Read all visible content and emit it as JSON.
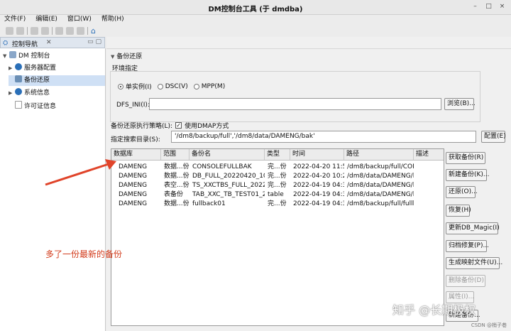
{
  "window": {
    "title": "DM控制台工具 (于 dmdba)",
    "minimize": "–",
    "maximize": "□",
    "close": "×"
  },
  "menu": [
    "文件(F)",
    "编辑(E)",
    "窗口(W)",
    "帮助(H)"
  ],
  "nav": {
    "tab_label": "控制导航",
    "tab_close": "✕",
    "items": [
      {
        "label": "DM 控制台",
        "level": 0,
        "expanded": true
      },
      {
        "label": "服务器配置",
        "level": 1,
        "expanded": false
      },
      {
        "label": "备份还原",
        "level": 1,
        "selected": true
      },
      {
        "label": "系统信息",
        "level": 1,
        "expanded": false
      },
      {
        "label": "许可证信息",
        "level": 1
      }
    ]
  },
  "panel": {
    "section_title": "备份还原",
    "env_group": "环境指定",
    "radios": [
      {
        "label": "单实例(I)",
        "checked": true
      },
      {
        "label": "DSC(V)",
        "checked": false
      },
      {
        "label": "MPP(M)",
        "checked": false
      }
    ],
    "dfs_label": "DFS_INI(I):",
    "dfs_value": "",
    "browse_btn": "浏览(B)...",
    "strategy_label": "备份还原执行策略(L):",
    "dmap_label": "使用DMAP方式",
    "dmap_checked": true,
    "dir_label": "指定搜索目录(S):",
    "dir_value": "'/dm8/backup/full','/dm8/data/DAMENG/bak'",
    "config_btn": "配置(E)"
  },
  "table": {
    "headers": [
      "数据库",
      "范围",
      "备份名",
      "类型",
      "时间",
      "路径",
      "描述"
    ],
    "rows": [
      [
        "DAMENG",
        "数据...份",
        "CONSOLEFULLBAK",
        "完...份",
        "2022-04-20 11:53...",
        "/dm8/backup/full/CON...",
        ""
      ],
      [
        "DAMENG",
        "数据...份",
        "DB_FULL_20220420_102...",
        "完...份",
        "2022-04-20 10:29...",
        "/dm8/data/DAMENG/b...",
        ""
      ],
      [
        "DAMENG",
        "表空...份",
        "TS_XXCTBS_FULL_2022_...",
        "完...份",
        "2022-04-19 04:36...",
        "/dm8/data/DAMENG/b...",
        ""
      ],
      [
        "DAMENG",
        "表备份",
        "TAB_XXC_TB_TEST01_20...",
        "table",
        "2022-04-19 04:35...",
        "/dm8/data/DAMENG/b...",
        ""
      ],
      [
        "DAMENG",
        "数据...份",
        "fullback01",
        "完...份",
        "2022-04-19 04:31...",
        "/dm8/backup/full/fullb...",
        ""
      ]
    ]
  },
  "actions": [
    {
      "label": "获取备份(R)",
      "enabled": true
    },
    {
      "label": "新建备份(K)...",
      "enabled": true
    },
    {
      "label": "还原(O)...",
      "enabled": true
    },
    {
      "label": "恢复(H)",
      "enabled": true
    },
    {
      "label": "更新DB_Magic(I)",
      "enabled": true
    },
    {
      "label": "归档修复(P)...",
      "enabled": true
    },
    {
      "label": "生成映射文件(U)...",
      "enabled": true
    },
    {
      "label": "删除备份(D)",
      "enabled": false
    },
    {
      "label": "属性(I)...",
      "enabled": false
    },
    {
      "label": "新建备份...",
      "enabled": true
    }
  ],
  "annotation": "多了一份最新的备份",
  "watermark": "知乎 @长期极权",
  "csdn": "CSDN @梢子巷",
  "colors": {
    "arrow": "#e0442a",
    "selection": "#cfe0f5",
    "accent": "#2a6fb8"
  }
}
